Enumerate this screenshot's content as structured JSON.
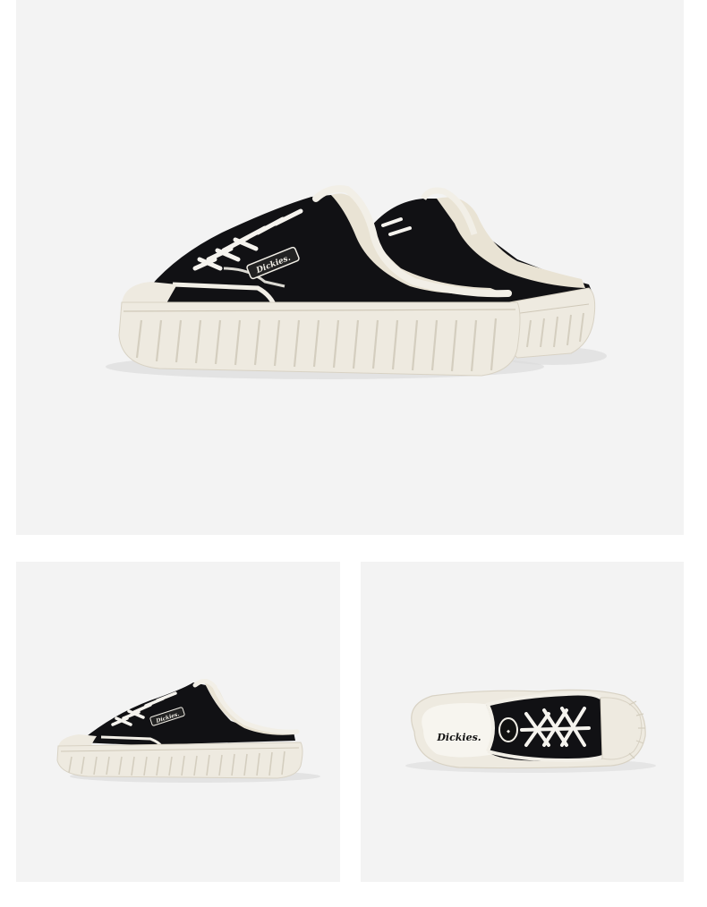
{
  "gallery": {
    "brand_text": "Dickies.",
    "panels": [
      {
        "id": "main",
        "view": "pair-three-quarter"
      },
      {
        "id": "side",
        "view": "single-side"
      },
      {
        "id": "top",
        "view": "top-down"
      }
    ]
  },
  "colors": {
    "background": "#f3f3f3",
    "upper": "#111114",
    "sole": "#eeeae0",
    "lining": "#e9e3d4",
    "piping": "#f2efe7",
    "laces": "#f5f3ee"
  }
}
